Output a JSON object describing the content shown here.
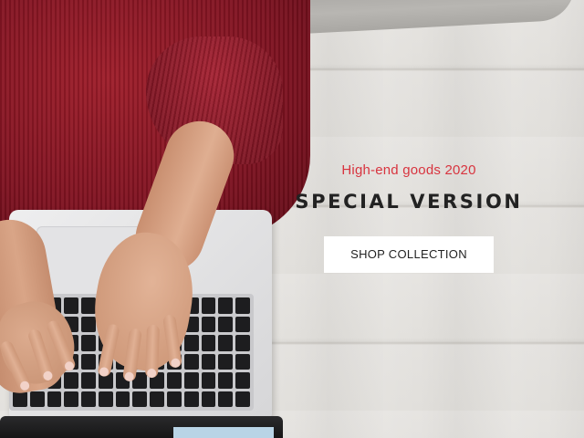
{
  "hero": {
    "tagline": "High-end goods 2020",
    "headline": "SPECIAL VERSION",
    "cta_label": "SHOP COLLECTION",
    "colors": {
      "tagline": "#d8343f",
      "headline": "#222222",
      "cta_background": "#ffffff",
      "cta_text": "#222222",
      "sweater": "#8a1622"
    },
    "image_subject": "person-typing-on-laptop"
  }
}
